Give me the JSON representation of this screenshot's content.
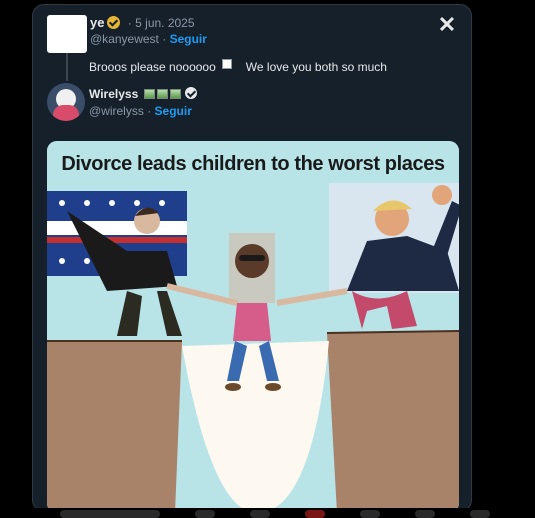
{
  "dialog": {
    "close_label": "✕"
  },
  "parent_post": {
    "name": "ye",
    "date": "5 jun. 2025",
    "handle": "@kanyewest",
    "follow": "Seguir",
    "text_before": "Brooos please noooooo",
    "text_after": "We love you both so much"
  },
  "reply_post": {
    "name": "Wirelyss",
    "handle": "@wirelyss",
    "follow": "Seguir"
  },
  "media": {
    "title": "Divorce leads children to the worst places"
  }
}
